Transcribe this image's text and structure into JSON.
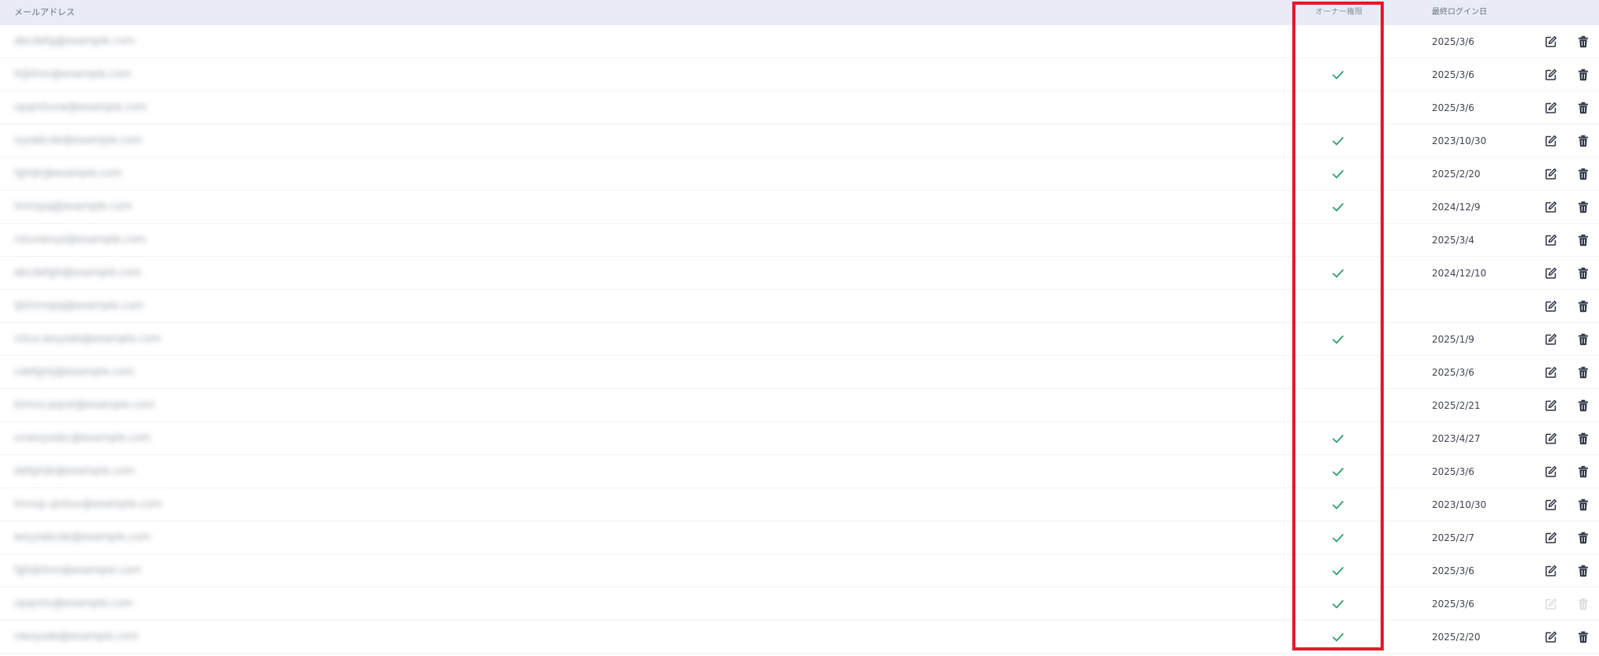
{
  "table": {
    "columns": {
      "email": "メールアドレス",
      "owner": "オーナー権限",
      "last_login": "最終ログイン日"
    },
    "rows": [
      {
        "email": "abcdefg@example.com",
        "owner": false,
        "last_login": "2025/3/6",
        "actions_disabled": false
      },
      {
        "email": "hijklmn@example.com",
        "owner": true,
        "last_login": "2025/3/6",
        "actions_disabled": false
      },
      {
        "email": "opqrstuvw@example.com",
        "owner": false,
        "last_login": "2025/3/6",
        "actions_disabled": false
      },
      {
        "email": "xyzabcde@example.com",
        "owner": true,
        "last_login": "2023/10/30",
        "actions_disabled": false
      },
      {
        "email": "fghijk@example.com",
        "owner": true,
        "last_login": "2025/2/20",
        "actions_disabled": false
      },
      {
        "email": "lmnopq@example.com",
        "owner": true,
        "last_login": "2024/12/9",
        "actions_disabled": false
      },
      {
        "email": "rstuvwxyz@example.com",
        "owner": false,
        "last_login": "2025/3/4",
        "actions_disabled": false
      },
      {
        "email": "abcdefgh@example.com",
        "owner": true,
        "last_login": "2024/12/10",
        "actions_disabled": false
      },
      {
        "email": "ijklmnopq@example.com",
        "owner": false,
        "last_login": "",
        "actions_disabled": false
      },
      {
        "email": "rstuv.wxyzab@example.com",
        "owner": true,
        "last_login": "2025/1/9",
        "actions_disabled": false
      },
      {
        "email": "cdefghij@example.com",
        "owner": false,
        "last_login": "2025/3/6",
        "actions_disabled": false
      },
      {
        "email": "klmno.pqrst@example.com",
        "owner": false,
        "last_login": "2025/2/21",
        "actions_disabled": false
      },
      {
        "email": "uvwxyzabc@example.com",
        "owner": true,
        "last_login": "2023/4/27",
        "actions_disabled": false
      },
      {
        "email": "defghijk@example.com",
        "owner": true,
        "last_login": "2025/3/6",
        "actions_disabled": false
      },
      {
        "email": "lmnop.qrstuv@example.com",
        "owner": true,
        "last_login": "2023/10/30",
        "actions_disabled": false
      },
      {
        "email": "wxyzabcde@example.com",
        "owner": true,
        "last_login": "2025/2/7",
        "actions_disabled": false
      },
      {
        "email": "fghijklmn@example.com",
        "owner": true,
        "last_login": "2025/3/6",
        "actions_disabled": false
      },
      {
        "email": "opqrstu@example.com",
        "owner": true,
        "last_login": "2025/3/6",
        "actions_disabled": true
      },
      {
        "email": "vwxyzab@example.com",
        "owner": true,
        "last_login": "2025/2/20",
        "actions_disabled": false
      }
    ]
  },
  "icons": {
    "owner_check": "check-icon",
    "edit": "edit-icon",
    "delete": "trash-icon"
  },
  "colors": {
    "check": "#2e9e6b",
    "icon": "#2f3542",
    "header_bg": "#e9ecf4",
    "highlight": "#e01b2a"
  }
}
